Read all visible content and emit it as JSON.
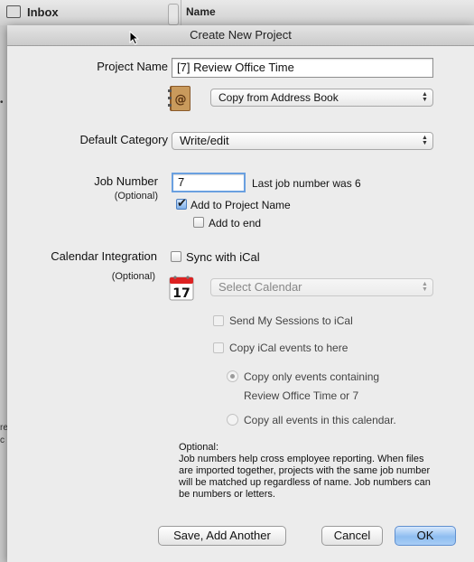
{
  "background": {
    "inbox_label": "Inbox",
    "name_header": "Name"
  },
  "dialog": {
    "title": "Create New Project",
    "project_name_label": "Project Name",
    "project_name_value": "[7] Review Office Time",
    "copy_source": "Copy from Address Book",
    "default_category_label": "Default Category",
    "default_category_value": "Write/edit",
    "job_number_label": "Job Number",
    "job_number_optional": "(Optional)",
    "job_number_value": "7",
    "last_job_note": "Last job number was 6",
    "add_to_project_name": "Add to Project Name",
    "add_to_project_name_checked": true,
    "add_to_end": "Add to end",
    "add_to_end_checked": false,
    "calendar_label": "Calendar Integration",
    "calendar_optional": "(Optional)",
    "sync_ical": "Sync with iCal",
    "sync_ical_checked": false,
    "select_calendar": "Select Calendar",
    "send_sessions": "Send My Sessions to iCal",
    "copy_events": "Copy iCal events to here",
    "copy_only_containing": "Copy only events containing",
    "containing_text": "Review Office Time or 7",
    "copy_all_events": "Copy all events in this calendar.",
    "help_title": "Optional:",
    "help_body": "Job numbers help cross employee reporting. When files are imported together, projects with the same job number will be matched up regardless of name. Job numbers can be numbers or letters.",
    "btn_save_another": "Save, Add Another",
    "btn_cancel": "Cancel",
    "btn_ok": "OK"
  },
  "colors": {
    "focus_ring": "#6aa0e0",
    "default_button": "#8ebdf0"
  },
  "icons": [
    "address-book-icon",
    "calendar-icon",
    "pointer-cursor-icon"
  ]
}
